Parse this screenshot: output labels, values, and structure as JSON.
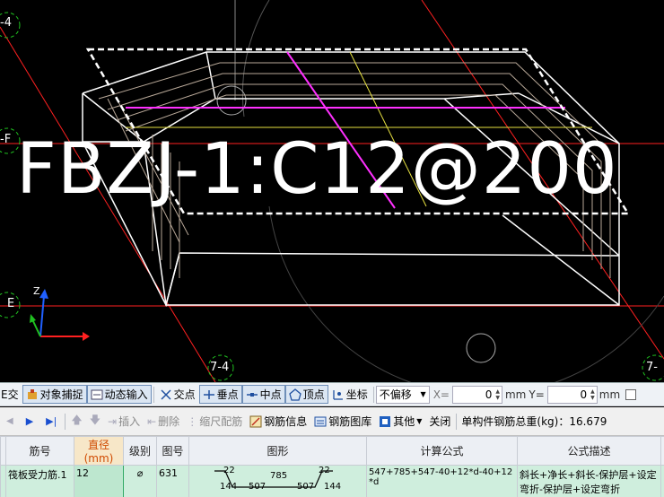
{
  "viewport": {
    "rebar_label": "FBZJ-1:C12@200",
    "axis_labels": {
      "top_left": "-4",
      "mid_left_f": "-F",
      "mid_left_e": "E",
      "bottom_74a": "7-4",
      "bottom_74b": "7-"
    },
    "ucs": {
      "z": "Z"
    }
  },
  "toolbar1": {
    "cut_label": "E交",
    "object_snap": "对象捕捉",
    "dynamic_input": "动态输入",
    "intersection": "交点",
    "perpendicular": "垂点",
    "midpoint": "中点",
    "vertex": "顶点",
    "coordinate": "坐标",
    "offset_select": "不偏移",
    "x_label": "X=",
    "x_value": "0",
    "x_unit": "mm",
    "y_label": "Y=",
    "y_value": "0",
    "y_unit": "mm"
  },
  "toolbar2": {
    "insert": "插入",
    "delete": "删除",
    "scale_rebar": "缩尺配筋",
    "rebar_info": "钢筋信息",
    "rebar_library": "钢筋图库",
    "other": "其他",
    "close": "关闭",
    "total_weight_label": "单构件钢筋总重(kg)：16.679"
  },
  "grid": {
    "headers": [
      "筋号",
      "直径(mm)",
      "级别",
      "图号",
      "图形",
      "计算公式",
      "公式描述"
    ],
    "rows": [
      {
        "name": "筏板受力筋.1",
        "diameter": "12",
        "grade": "⌀",
        "figure_no": "631",
        "shape": {
          "a": "22",
          "b": "785",
          "c": "22",
          "d": "144",
          "e": "507",
          "f": "507",
          "g": "144"
        },
        "formula": "547+785+547-40+12*d-40+12*d",
        "description": "斜长+净长+斜长-保护层+设定弯折-保护层+设定弯折"
      }
    ]
  },
  "colors": {
    "background": "#000000",
    "grid_line_red": "#ff2020",
    "slab_outline": "#ffffff",
    "rebar_magenta": "#ff30ff",
    "rebar_yellow": "#e6e040",
    "rebar_gray": "#b8a898",
    "selected_row": "#cfeedd",
    "header_highlight": "#d04a00"
  }
}
